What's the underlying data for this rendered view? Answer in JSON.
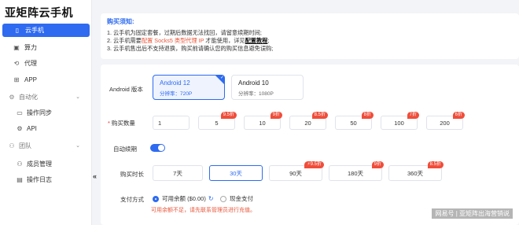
{
  "brand": "亚矩阵云手机",
  "sidebar": {
    "items": [
      {
        "label": "云手机",
        "icon": "phone-icon",
        "active": true
      },
      {
        "label": "算力",
        "icon": "compute-icon"
      },
      {
        "label": "代理",
        "icon": "proxy-icon"
      },
      {
        "label": "APP",
        "icon": "app-grid-icon"
      }
    ],
    "groups": [
      {
        "label": "自动化",
        "icon": "automation-icon",
        "children": [
          {
            "label": "操作同步",
            "icon": "sync-icon"
          },
          {
            "label": "API",
            "icon": "api-icon"
          }
        ]
      },
      {
        "label": "团队",
        "icon": "team-icon",
        "children": [
          {
            "label": "成员管理",
            "icon": "members-icon"
          },
          {
            "label": "操作日志",
            "icon": "log-icon"
          }
        ]
      }
    ],
    "collapse_glyph": "«"
  },
  "notice": {
    "title": "购买须知:",
    "line1": "1. 云手机为固定套餐，过期后数据无法找回，请留意续期时间;",
    "line2_pre": "2. 云手机需要",
    "line2_hl": "配置 Socks5 类型代理 IP",
    "line2_mid": " 才能使用，详见",
    "line2_link": "配置教程",
    "line2_post": ";",
    "line3": "3. 云手机售出后不支持退换，购买前请确认您的购买信息避免误购;"
  },
  "form": {
    "android_label": "Android 版本",
    "versions": [
      {
        "name": "Android 12",
        "res": "分辨率：720P",
        "selected": true
      },
      {
        "name": "Android 10",
        "res": "分辨率：1080P",
        "selected": false
      }
    ],
    "qty_label": "购买数量",
    "qty_value": "1",
    "qty_options": [
      {
        "label": "5",
        "badge": "9.5折"
      },
      {
        "label": "10",
        "badge": "9折"
      },
      {
        "label": "20",
        "badge": "8.5折"
      },
      {
        "label": "50",
        "badge": "8折"
      },
      {
        "label": "100",
        "badge": "7折"
      },
      {
        "label": "200",
        "badge": "6折"
      }
    ],
    "auto_renew_label": "自动续期",
    "auto_renew_on": true,
    "duration_label": "购买时长",
    "durations": [
      {
        "label": "7天",
        "badge": ""
      },
      {
        "label": "30天",
        "badge": "",
        "selected": true
      },
      {
        "label": "90天",
        "badge": "⚡9.5折"
      },
      {
        "label": "180天",
        "badge": "9折"
      },
      {
        "label": "360天",
        "badge": "8.5折"
      }
    ],
    "pay_label": "支付方式",
    "pay_balance": "可用余额 ($0.00)",
    "pay_cash": "现金支付",
    "pay_warning": "可用余额不足，请先联系管理员进行充值。"
  },
  "watermark": "网易号 | 亚矩阵出海营销说"
}
